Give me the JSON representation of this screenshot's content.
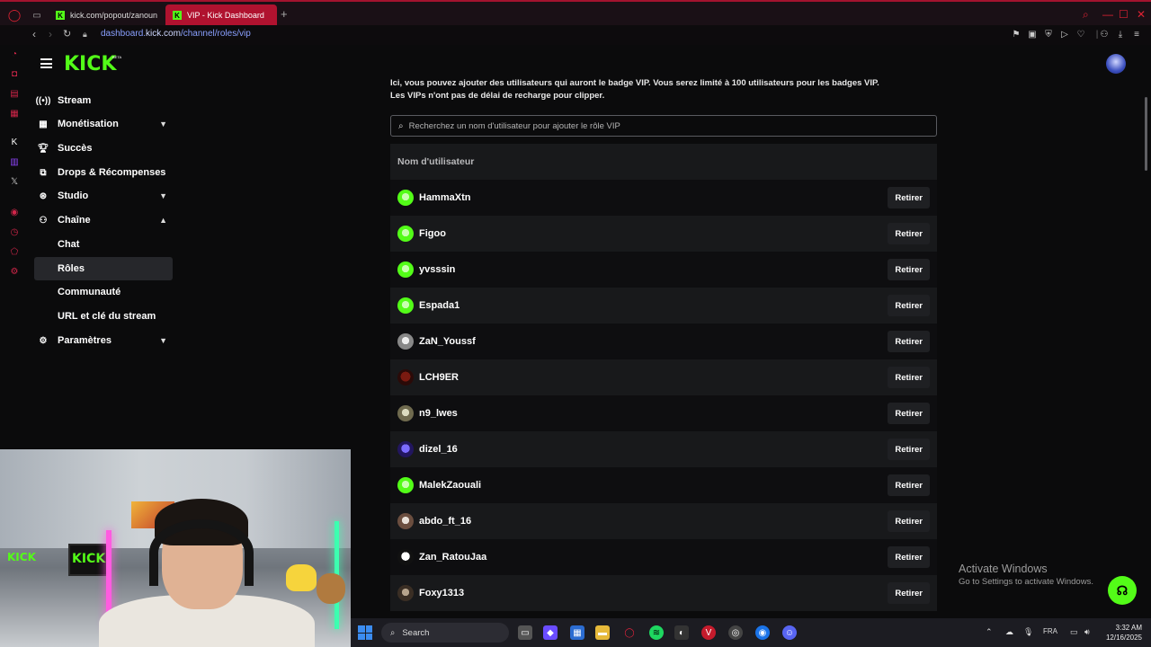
{
  "browser": {
    "tabs": [
      {
        "label": "kick.com/popout/zanoun"
      },
      {
        "label": "VIP - Kick Dashboard"
      }
    ],
    "new_tab": "+",
    "url_prefix": "dashboard.",
    "url_domain": "kick.com",
    "url_path": "/channel/roles/vip"
  },
  "header": {
    "logo": "KICK",
    "logo_badge": "BETA"
  },
  "sidebar": {
    "items": [
      {
        "label": "Stream",
        "icon": "broadcast-icon"
      },
      {
        "label": "Monétisation",
        "icon": "money-icon"
      },
      {
        "label": "Succès",
        "icon": "trophy-icon"
      },
      {
        "label": "Drops & Récompenses",
        "icon": "gift-icon"
      },
      {
        "label": "Studio",
        "icon": "studio-icon"
      },
      {
        "label": "Chaîne",
        "icon": "channel-icon"
      },
      {
        "label": "Chat"
      },
      {
        "label": "Rôles"
      },
      {
        "label": "Communauté"
      },
      {
        "label": "URL et clé du stream"
      },
      {
        "label": "Paramètres",
        "icon": "gear-icon"
      }
    ]
  },
  "main": {
    "intro_line1": "Ici, vous pouvez ajouter des utilisateurs qui auront le badge VIP. Vous serez limité à 100 utilisateurs pour les badges VIP.",
    "intro_line2": "Les VIPs n'ont pas de délai de recharge pour clipper.",
    "search_placeholder": "Recherchez un nom d'utilisateur pour ajouter le rôle VIP",
    "column_username": "Nom d'utilisateur",
    "remove_label": "Retirer",
    "users": [
      {
        "name": "HammaXtn"
      },
      {
        "name": "Figoo"
      },
      {
        "name": "yvsssin"
      },
      {
        "name": "Espada1"
      },
      {
        "name": "ZaN_Youssf"
      },
      {
        "name": "LCH9ER"
      },
      {
        "name": "n9_lwes"
      },
      {
        "name": "dizel_16"
      },
      {
        "name": "MalekZaouali"
      },
      {
        "name": "abdo_ft_16"
      },
      {
        "name": "Zan_RatouJaa"
      },
      {
        "name": "Foxy1313"
      }
    ]
  },
  "windows": {
    "activate_title": "Activate Windows",
    "activate_sub": "Go to Settings to activate Windows.",
    "search_label": "Search",
    "lang": "FRA",
    "time": "3:32 AM",
    "date": "12/16/2025"
  },
  "colors": {
    "accent": "#53fc18",
    "browser_red": "#b0122f",
    "background": "#0b0b0c",
    "row_alt": "#18191b"
  }
}
